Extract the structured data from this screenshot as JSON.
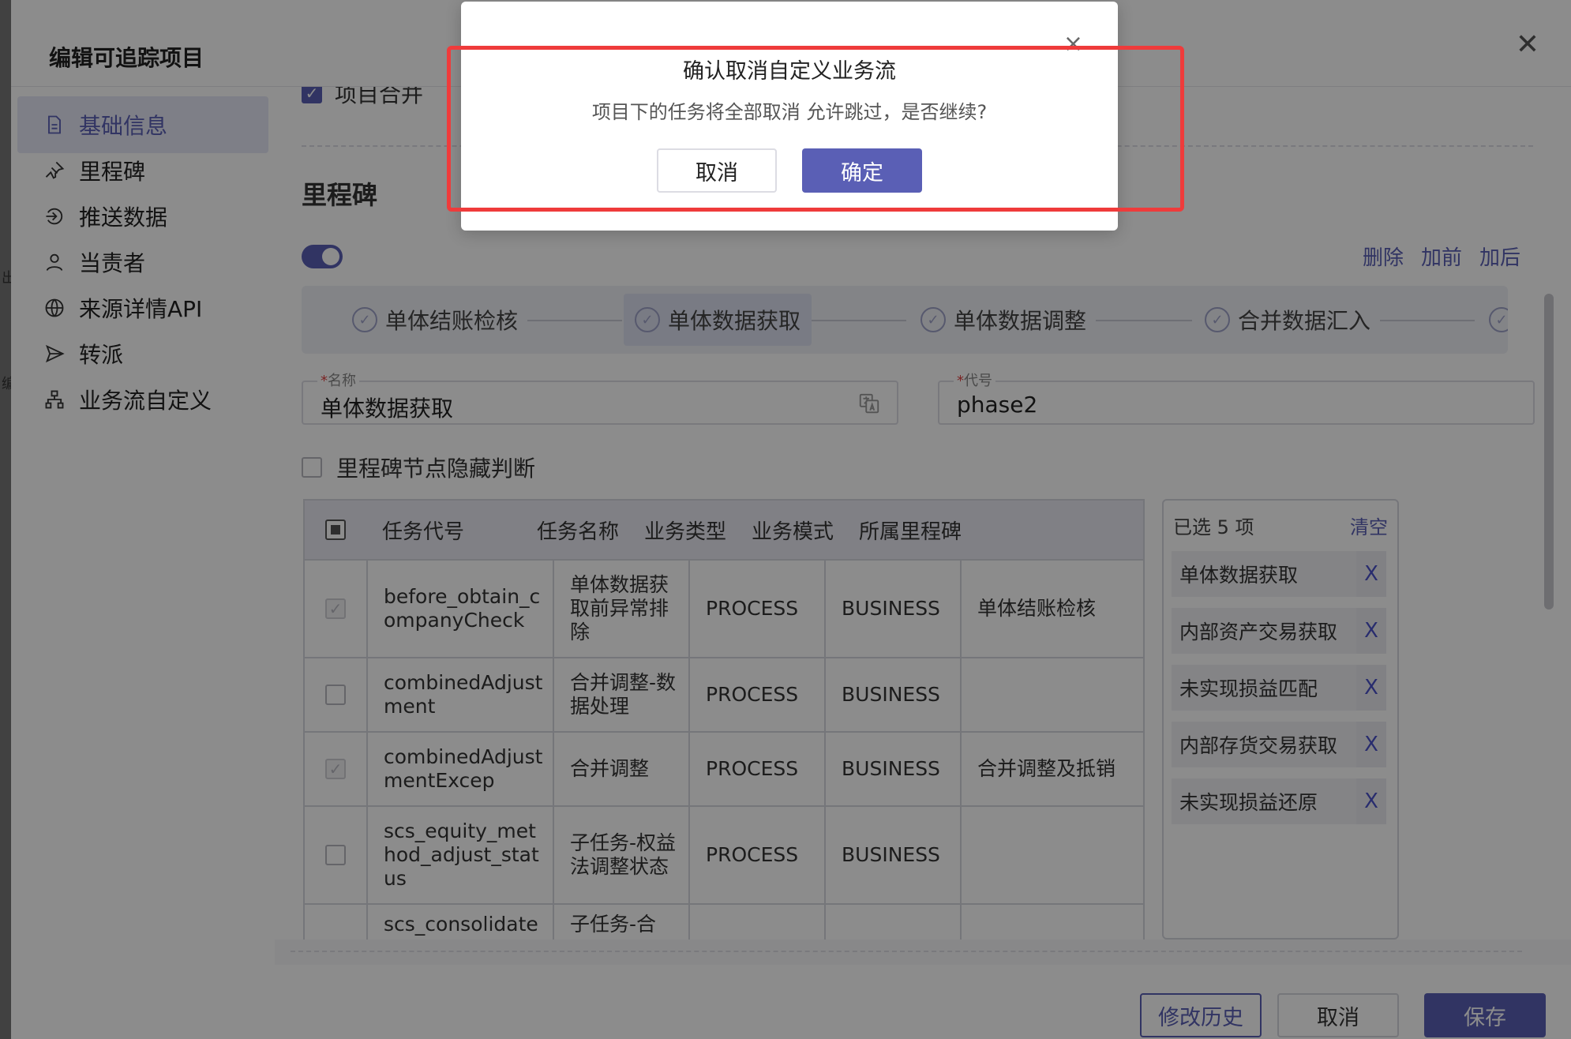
{
  "background": {
    "edge_chars": [
      "出",
      "编"
    ]
  },
  "drawer": {
    "title": "编辑可追踪项目",
    "nav": [
      {
        "label": "基础信息",
        "icon": "document-icon",
        "active": true
      },
      {
        "label": "里程碑",
        "icon": "pin-icon"
      },
      {
        "label": "推送数据",
        "icon": "push-icon"
      },
      {
        "label": "当责者",
        "icon": "user-icon"
      },
      {
        "label": "来源详情API",
        "icon": "globe-icon"
      },
      {
        "label": "转派",
        "icon": "send-icon"
      },
      {
        "label": "业务流自定义",
        "icon": "flow-icon"
      }
    ],
    "merge_label": "项目合并",
    "milestone_title": "里程碑",
    "ops": {
      "delete": "删除",
      "add_before": "加前",
      "add_after": "加后"
    },
    "steps": [
      "单体结账检核",
      "单体数据获取",
      "单体数据调整",
      "合并数据汇入"
    ],
    "name_field": {
      "label": "名称",
      "required": "*",
      "value": "单体数据获取"
    },
    "code_field": {
      "label": "代号",
      "required": "*",
      "value": "phase2"
    },
    "hide_label": "里程碑节点隐藏判断",
    "table": {
      "headers": [
        "任务代号",
        "任务名称",
        "业务类型",
        "业务模式",
        "所属里程碑"
      ],
      "rows": [
        {
          "code": "before_obtain_companyCheck",
          "name": "单体数据获取前异常排除",
          "type": "PROCESS",
          "mode": "BUSINESS",
          "milestone": "单体结账检核",
          "checked": "disabled"
        },
        {
          "code": "combinedAdjustment",
          "name": "合并调整-数据处理",
          "type": "PROCESS",
          "mode": "BUSINESS",
          "milestone": "",
          "checked": "off"
        },
        {
          "code": "combinedAdjustmentExcep",
          "name": "合并调整",
          "type": "PROCESS",
          "mode": "BUSINESS",
          "milestone": "合并调整及抵销",
          "checked": "disabled"
        },
        {
          "code": "scs_equity_method_adjust_status",
          "name": "子任务-权益法调整状态",
          "type": "PROCESS",
          "mode": "BUSINESS",
          "milestone": "",
          "checked": "off"
        },
        {
          "code": "scs_consolidate",
          "name": "子任务-合",
          "type": "",
          "mode": "",
          "milestone": "",
          "checked": "off"
        }
      ]
    },
    "selected": {
      "header": "已选 5 项",
      "clear": "清空",
      "items": [
        "单体数据获取",
        "内部资产交易获取",
        "未实现损益匹配",
        "内部存货交易获取",
        "未实现损益还原"
      ],
      "remove": "X"
    },
    "footer": {
      "history": "修改历史",
      "cancel": "取消",
      "save": "保存"
    }
  },
  "modal": {
    "title": "确认取消自定义业务流",
    "message": "项目下的任务将全部取消 允许跳过，是否继续?",
    "cancel": "取消",
    "confirm": "确定",
    "close": "×"
  },
  "colors": {
    "accent": "#5a5fb5",
    "highlight": "#ef3b3b"
  }
}
